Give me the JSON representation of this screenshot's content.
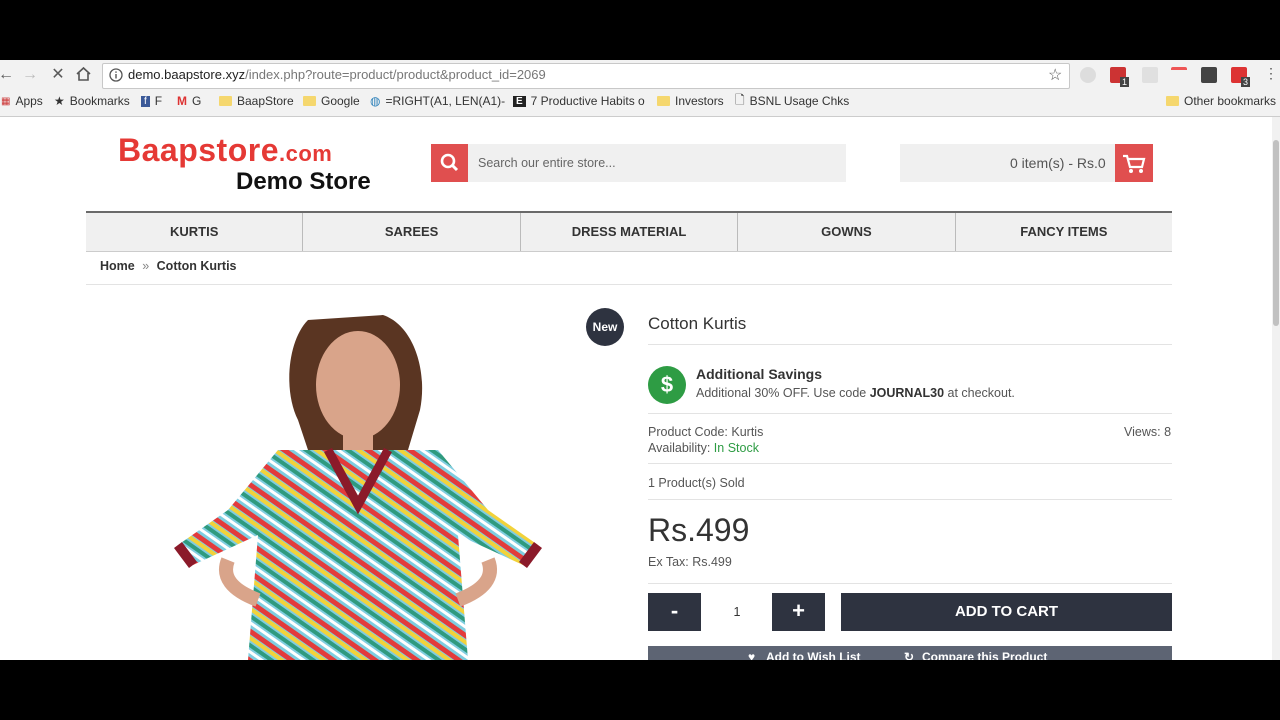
{
  "browser": {
    "url_host": "demo.baapstore.xyz",
    "url_path": "/index.php?route=product/product&product_id=2069",
    "bookmarks": [
      "Apps",
      "Bookmarks",
      "F",
      "G",
      "BaapStore",
      "Google",
      "=RIGHT(A1, LEN(A1)-",
      "7 Productive Habits o",
      "Investors",
      "BSNL Usage Chks"
    ],
    "other_bookmarks": "Other bookmarks",
    "ext_badges": [
      "1",
      "3"
    ]
  },
  "header": {
    "logo_main": "Baapstore",
    "logo_tld": ".com",
    "logo_sub": "Demo Store",
    "search_placeholder": "Search our entire store...",
    "cart_text": "0 item(s) - Rs.0"
  },
  "menu": [
    "KURTIS",
    "SAREES",
    "DRESS MATERIAL",
    "GOWNS",
    "FANCY ITEMS"
  ],
  "breadcrumb": {
    "home": "Home",
    "sep": "»",
    "current": "Cotton Kurtis"
  },
  "product": {
    "badge": "New",
    "title": "Cotton Kurtis",
    "savings_heading": "Additional Savings",
    "savings_text_pre": "Additional 30% OFF. Use code ",
    "savings_code": "JOURNAL30",
    "savings_text_post": " at checkout.",
    "code_label": "Product Code: Kurtis",
    "availability_label": "Availability:",
    "availability_value": "In Stock",
    "views": "Views: 8",
    "sold": "1 Product(s) Sold",
    "price": "Rs.499",
    "ex_tax": "Ex Tax: Rs.499",
    "qty_value": "1",
    "minus": "-",
    "plus": "+",
    "add_to_cart": "ADD TO CART",
    "wishlist": "Add to Wish List",
    "compare": "Compare this Product"
  },
  "colors": {
    "accent": "#e04f4f",
    "dark": "#2e3340",
    "success": "#2e9c44"
  }
}
